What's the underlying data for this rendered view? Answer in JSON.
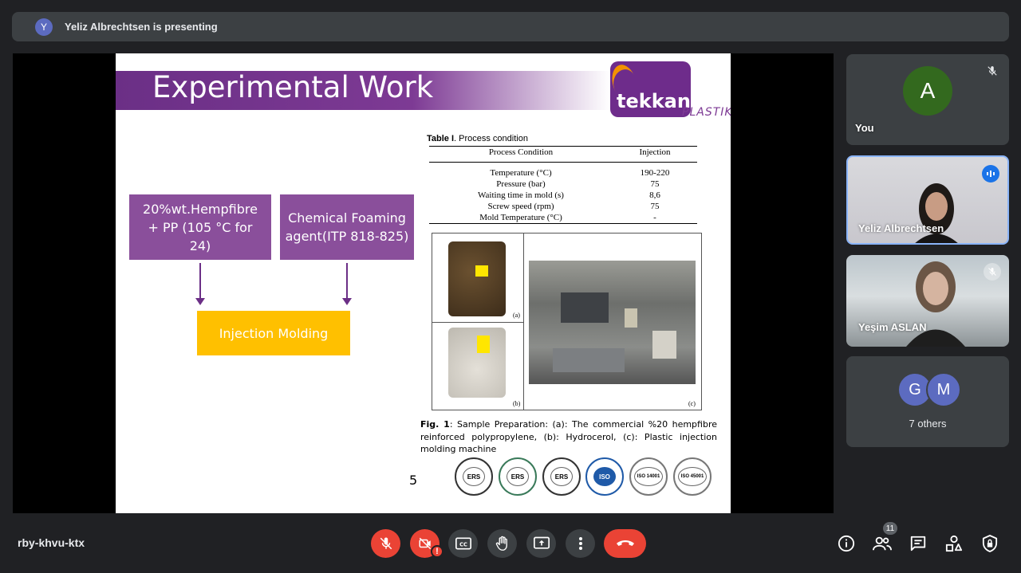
{
  "banner": {
    "avatar_letter": "Y",
    "text": "Yeliz Albrechtsen is presenting"
  },
  "slide": {
    "title": "Experimental Work",
    "logo_main": "tekkan",
    "logo_sub": "PLASTIK",
    "box1": "20%wt.Hempfibre + PP (105 °C for 24)",
    "box2": "Chemical Foaming agent(ITP 818-825)",
    "box3": "Injection Molding",
    "table": {
      "caption_bold": "Table I",
      "caption_rest": ". Process condition",
      "headers": [
        "Process Condition",
        "Injection"
      ],
      "rows": [
        [
          "Temperature (°C)",
          "190-220"
        ],
        [
          "Pressure (bar)",
          "75"
        ],
        [
          "Waiting time in mold (s)",
          "8,6"
        ],
        [
          "Screw speed (rpm)",
          "75"
        ],
        [
          "Mold Temperature (°C)",
          "-"
        ]
      ]
    },
    "figure_labels": [
      "(a)",
      "(b)",
      "(c)"
    ],
    "fig_caption_bold": "Fig. 1",
    "fig_caption_rest": ": Sample Preparation: (a): The commercial %20 hempfibre reinforced polypropylene, (b): Hydrocerol, (c): Plastic injection molding machine",
    "page_number": "5",
    "seals": [
      "ERS",
      "ERS",
      "ERS",
      "ISO",
      "ISO 14001",
      "ISO 45001"
    ]
  },
  "participants": {
    "you": {
      "letter": "A",
      "name": "You",
      "color": "#33691e"
    },
    "yeliz": {
      "name": "Yeliz Albrechtsen"
    },
    "yesim": {
      "name": "Yeşim ASLAN"
    },
    "others": {
      "letters": [
        "G",
        "M"
      ],
      "label": "7 others"
    }
  },
  "bottom": {
    "meeting_code": "rby-khvu-ktx",
    "people_count": "11",
    "alert": "!"
  },
  "colors": {
    "accent_red": "#ea4335",
    "presenter_border": "#8ab4f8",
    "slide_purple": "#8a4f9b",
    "yellow_box": "#ffc000"
  }
}
